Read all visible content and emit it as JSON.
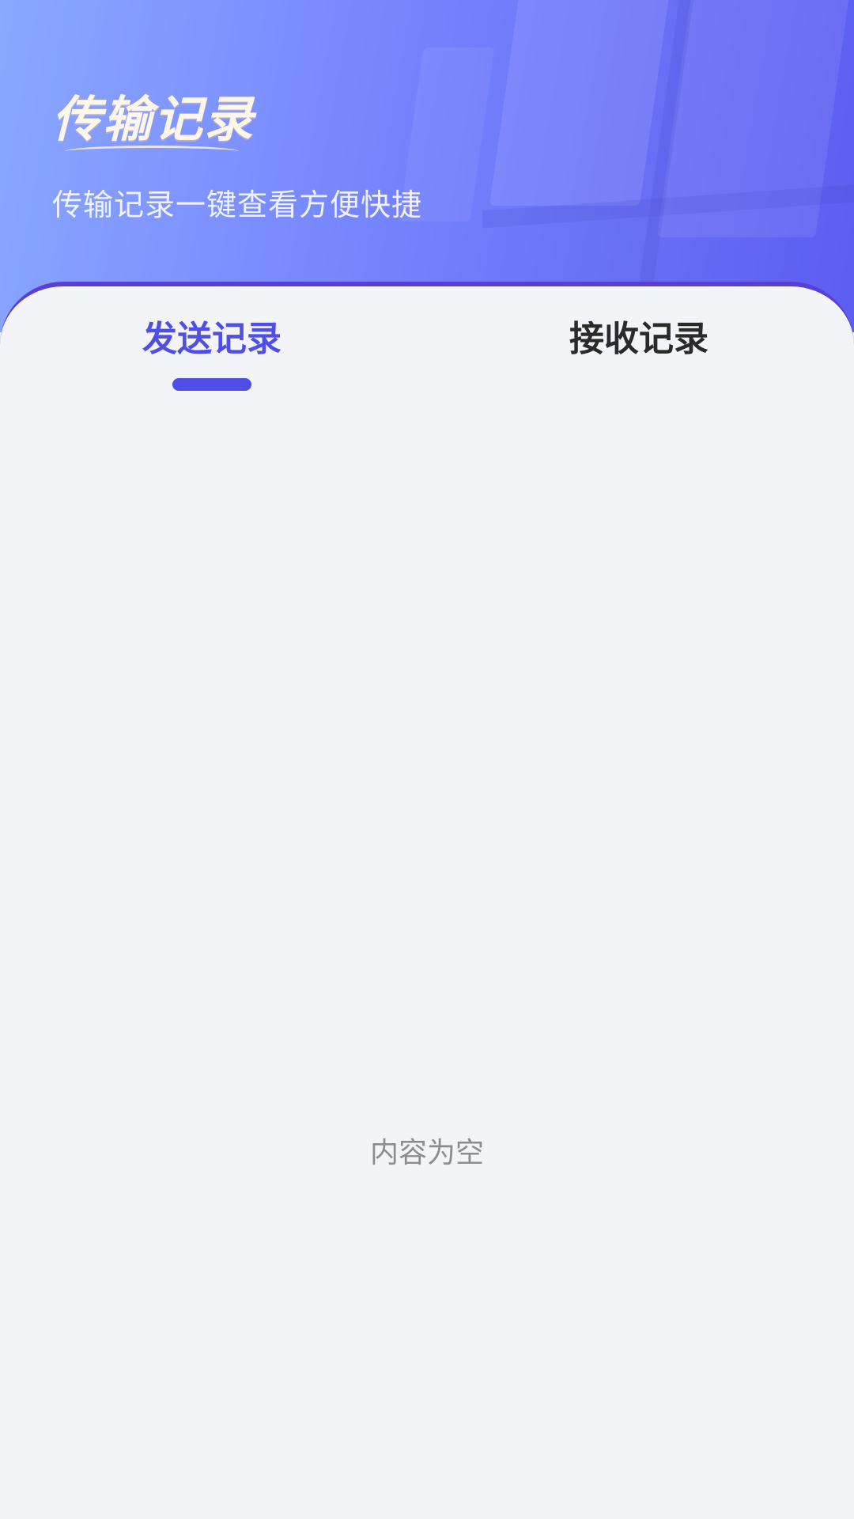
{
  "header": {
    "title": "传输记录",
    "subtitle": "传输记录一键查看方便快捷"
  },
  "tabs": [
    {
      "label": "发送记录",
      "active": true
    },
    {
      "label": "接收记录",
      "active": false
    }
  ],
  "content": {
    "empty_text": "内容为空"
  },
  "colors": {
    "accent": "#4f4fe8",
    "background": "#f3f4f7"
  }
}
